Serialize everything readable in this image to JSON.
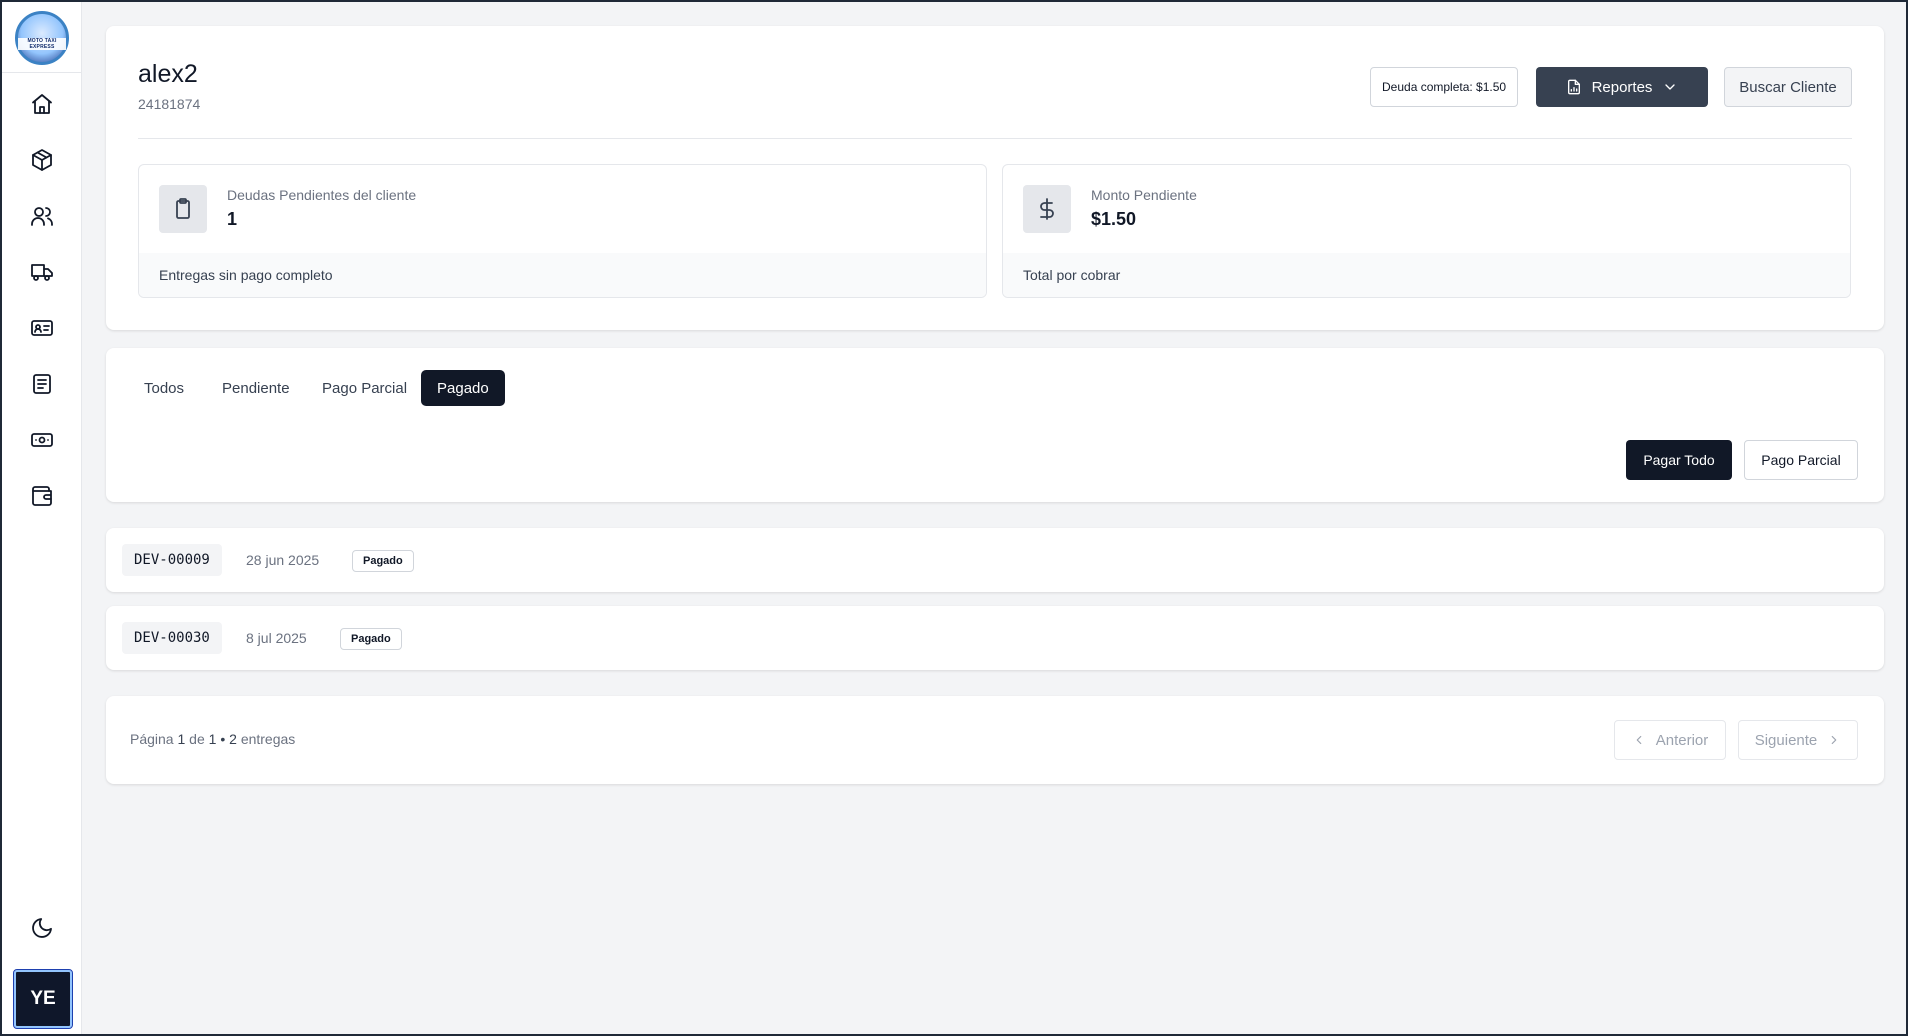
{
  "sidebar": {
    "logo_text": "MOTO TAXI EXPRESS",
    "nav_items": [
      {
        "name": "home",
        "icon": "home-icon"
      },
      {
        "name": "packages",
        "icon": "box-icon"
      },
      {
        "name": "clients",
        "icon": "users-icon"
      },
      {
        "name": "deliveries",
        "icon": "truck-icon"
      },
      {
        "name": "drivers",
        "icon": "id-card-icon"
      },
      {
        "name": "reports",
        "icon": "list-icon"
      },
      {
        "name": "payments",
        "icon": "banknote-icon"
      },
      {
        "name": "wallet",
        "icon": "wallet-icon"
      }
    ],
    "theme_icon": "moon-icon",
    "avatar_initials": "YE"
  },
  "header": {
    "client_name": "alex2",
    "client_id": "24181874",
    "debt_badge": "Deuda completa: $1.50",
    "reports_label": "Reportes",
    "search_label": "Buscar Cliente"
  },
  "stats": [
    {
      "label": "Deudas Pendientes del cliente",
      "value": "1",
      "footer": "Entregas sin pago completo",
      "icon": "clipboard-icon"
    },
    {
      "label": "Monto Pendiente",
      "value": "$1.50",
      "footer": "Total por cobrar",
      "icon": "dollar-icon"
    }
  ],
  "tabs": [
    {
      "label": "Todos",
      "active": false
    },
    {
      "label": "Pendiente",
      "active": false
    },
    {
      "label": "Pago Parcial",
      "active": false
    },
    {
      "label": "Pagado",
      "active": true
    }
  ],
  "actions": {
    "pay_all": "Pagar Todo",
    "partial_payment": "Pago Parcial"
  },
  "deliveries": [
    {
      "code": "DEV-00009",
      "date": "28 jun 2025",
      "status": "Pagado"
    },
    {
      "code": "DEV-00030",
      "date": "8 jul 2025",
      "status": "Pagado"
    }
  ],
  "pagination": {
    "page_word": "Página",
    "current_page": "1",
    "of_word": "de",
    "total_pages": "1",
    "separator": "•",
    "total_count": "2",
    "items_word": "entregas",
    "prev_label": "Anterior",
    "next_label": "Siguiente"
  }
}
